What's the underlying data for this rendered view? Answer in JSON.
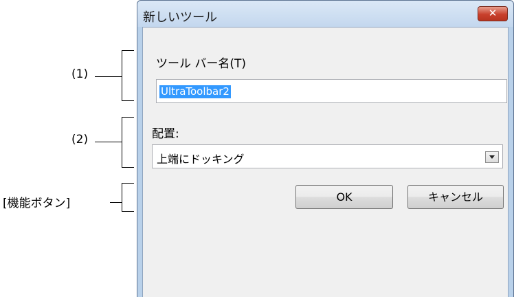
{
  "annotations": {
    "one": "(1)",
    "two": "(2)",
    "buttons": "[機能ボタン]"
  },
  "dialog": {
    "title": "新しいツール",
    "close_label": "✕",
    "toolbar_name_label": "ツール バー名(T)",
    "toolbar_name_value": "UltraToolbar2",
    "position_label": "配置:",
    "position_selected": "上端にドッキング",
    "ok_label": "OK",
    "cancel_label": "キャンセル"
  },
  "colors": {
    "selection": "#3399ff",
    "close_button": "#c8402c",
    "frame": "#b9d1ea"
  }
}
